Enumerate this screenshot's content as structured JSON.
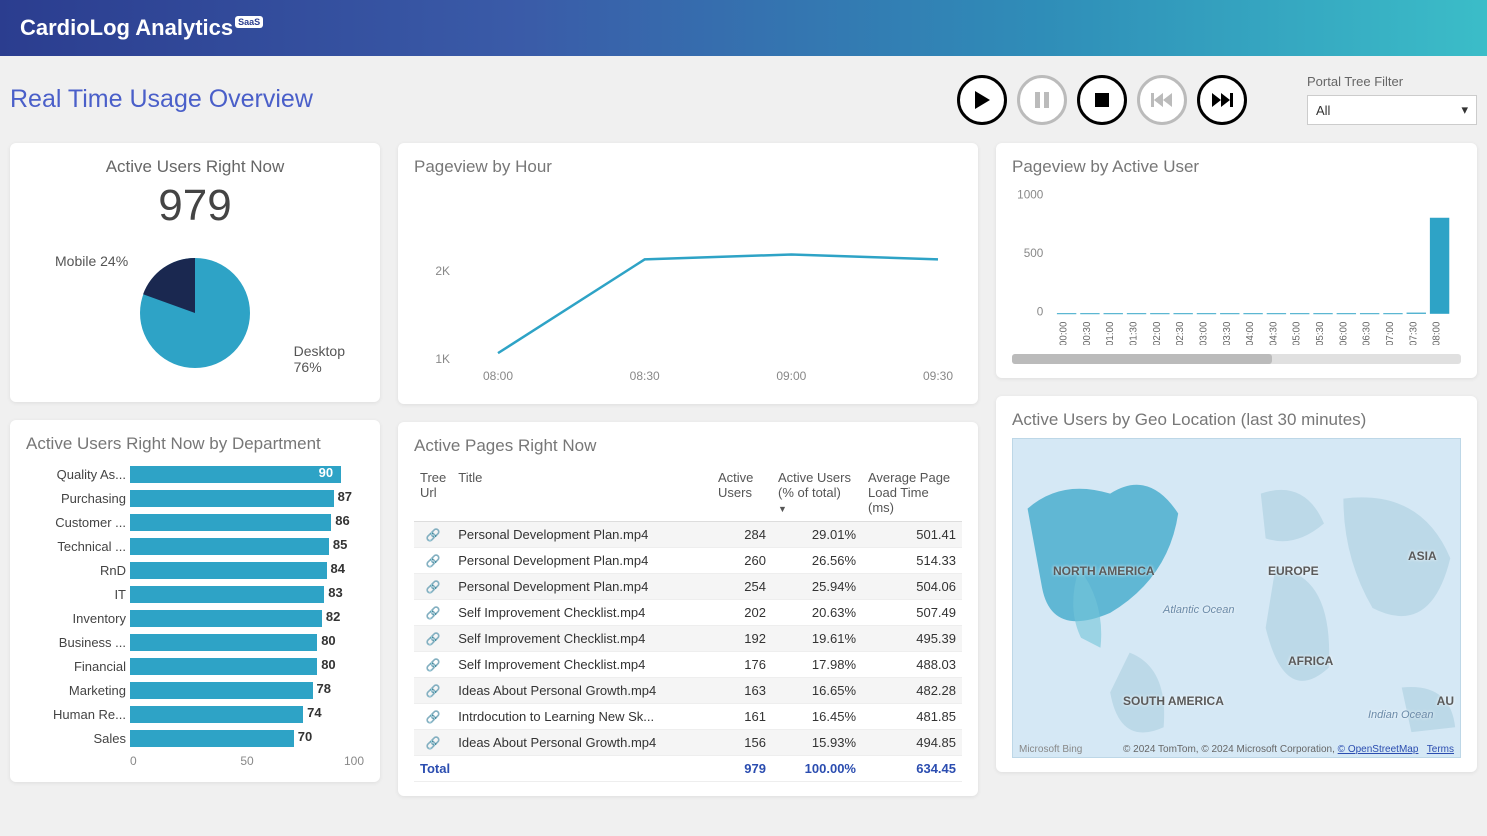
{
  "brand": {
    "name": "CardioLog Analytics",
    "badge": "SaaS"
  },
  "page_title": "Real Time Usage Overview",
  "filter": {
    "label": "Portal Tree Filter",
    "value": "All"
  },
  "kpi": {
    "title": "Active Users Right Now",
    "value": "979"
  },
  "pie": {
    "mobile_label": "Mobile 24%",
    "desktop_label_line1": "Desktop",
    "desktop_label_line2": "76%"
  },
  "dept_chart_title": "Active Users Right Now by Department",
  "pageview_hour_title": "Pageview by Hour",
  "pageview_user_title": "Pageview by Active User",
  "active_pages_title": "Active Pages Right Now",
  "geo_title": "Active Users by Geo Location (last 30 minutes)",
  "table": {
    "headers": {
      "tree": "Tree Url",
      "title": "Title",
      "users": "Active Users",
      "pct": "Active Users (% of total)",
      "load": "Average Page Load Time (ms)"
    },
    "rows": [
      {
        "title": "Personal Development Plan.mp4",
        "users": "284",
        "pct": "29.01%",
        "load": "501.41"
      },
      {
        "title": "Personal Development Plan.mp4",
        "users": "260",
        "pct": "26.56%",
        "load": "514.33"
      },
      {
        "title": "Personal Development Plan.mp4",
        "users": "254",
        "pct": "25.94%",
        "load": "504.06"
      },
      {
        "title": "Self Improvement Checklist.mp4",
        "users": "202",
        "pct": "20.63%",
        "load": "507.49"
      },
      {
        "title": "Self Improvement Checklist.mp4",
        "users": "192",
        "pct": "19.61%",
        "load": "495.39"
      },
      {
        "title": "Self Improvement Checklist.mp4",
        "users": "176",
        "pct": "17.98%",
        "load": "488.03"
      },
      {
        "title": "Ideas About Personal Growth.mp4",
        "users": "163",
        "pct": "16.65%",
        "load": "482.28"
      },
      {
        "title": "Intrdocution to Learning New Sk...",
        "users": "161",
        "pct": "16.45%",
        "load": "481.85"
      },
      {
        "title": "Ideas About Personal Growth.mp4",
        "users": "156",
        "pct": "15.93%",
        "load": "494.85"
      }
    ],
    "total": {
      "label": "Total",
      "users": "979",
      "pct": "100.00%",
      "load": "634.45"
    }
  },
  "map": {
    "labels": {
      "na": "NORTH AMERICA",
      "sa": "SOUTH AMERICA",
      "eu": "EUROPE",
      "af": "AFRICA",
      "as": "ASIA",
      "au": "AU",
      "atl": "Atlantic Ocean",
      "ind": "Indian Ocean"
    },
    "attr": {
      "bing": "Microsoft Bing",
      "copyright": "© 2024 TomTom, © 2024 Microsoft Corporation, ",
      "osm": "© OpenStreetMap",
      "terms": "Terms"
    }
  },
  "chart_data": [
    {
      "id": "device_split",
      "type": "pie",
      "title": "Active Users Right Now",
      "series": [
        {
          "name": "Mobile",
          "value": 24
        },
        {
          "name": "Desktop",
          "value": 76
        }
      ]
    },
    {
      "id": "dept_bar",
      "type": "bar",
      "title": "Active Users Right Now by Department",
      "categories": [
        "Quality As...",
        "Purchasing",
        "Customer ...",
        "Technical ...",
        "RnD",
        "IT",
        "Inventory",
        "Business ...",
        "Financial",
        "Marketing",
        "Human Re...",
        "Sales"
      ],
      "values": [
        90,
        87,
        86,
        85,
        84,
        83,
        82,
        80,
        80,
        78,
        74,
        70
      ],
      "xlabel": "",
      "ylabel": "",
      "xlim": [
        0,
        100
      ],
      "x_ticks": [
        0,
        50,
        100
      ]
    },
    {
      "id": "pageview_hour",
      "type": "line",
      "title": "Pageview by Hour",
      "x": [
        "08:00",
        "08:30",
        "09:00",
        "09:30"
      ],
      "values": [
        1100,
        2050,
        2100,
        2050
      ],
      "ylim": [
        1000,
        2500
      ],
      "y_ticks": [
        1000,
        2000
      ],
      "y_tick_labels": [
        "1K",
        "2K"
      ]
    },
    {
      "id": "pageview_user",
      "type": "bar",
      "title": "Pageview by Active User",
      "categories": [
        "00:00",
        "00:30",
        "01:00",
        "01:30",
        "02:00",
        "02:30",
        "03:00",
        "03:30",
        "04:00",
        "04:30",
        "05:00",
        "05:30",
        "06:00",
        "06:30",
        "07:00",
        "07:30",
        "08:00"
      ],
      "values": [
        5,
        5,
        5,
        5,
        5,
        5,
        5,
        5,
        5,
        5,
        5,
        5,
        5,
        5,
        5,
        10,
        820
      ],
      "ylim": [
        0,
        1000
      ],
      "y_ticks": [
        0,
        500,
        1000
      ]
    }
  ]
}
